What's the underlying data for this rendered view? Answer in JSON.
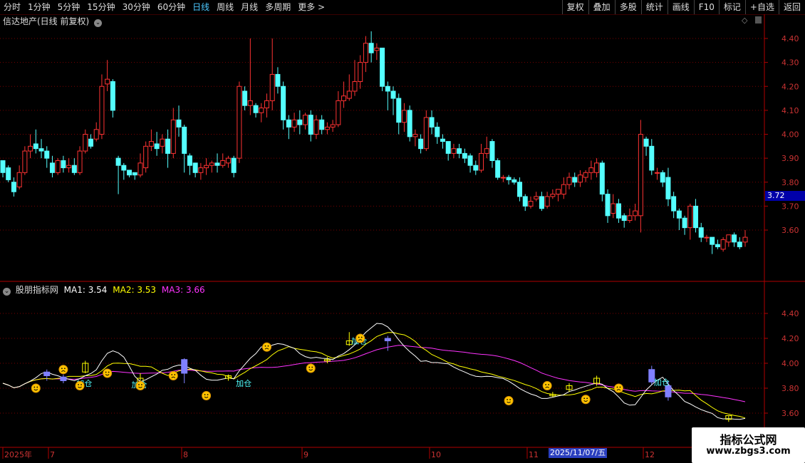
{
  "topbar": {
    "tabs": [
      "分时",
      "1分钟",
      "5分钟",
      "15分钟",
      "30分钟",
      "60分钟",
      "日线",
      "周线",
      "月线",
      "多周期",
      "更多 >"
    ],
    "active_tab": "日线",
    "tools": [
      "复权",
      "叠加",
      "多股",
      "统计",
      "画线",
      "F10",
      "标记",
      "+自选",
      "返回"
    ]
  },
  "main_pane": {
    "title": "信达地产(日线 前复权)",
    "price_labels": [
      "4.40",
      "4.30",
      "4.20",
      "4.10",
      "4.00",
      "3.90",
      "3.80",
      "3.70",
      "3.60"
    ],
    "current_price": "3.72"
  },
  "indicator_pane": {
    "name": "股朋指标网",
    "ma1_label": "MA1: 3.54",
    "ma2_label": "MA2: 3.53",
    "ma3_label": "MA3: 3.66",
    "ma1_color": "#ffffff",
    "ma2_color": "#ffff00",
    "ma3_color": "#ff33ff",
    "price_labels": [
      "4.40",
      "4.20",
      "4.00",
      "3.80",
      "3.60"
    ],
    "annotation_text": "加仓"
  },
  "time_axis": {
    "labels": [
      "2025年",
      "7",
      "8",
      "9",
      "10",
      "11",
      "12"
    ],
    "cursor_date": "2025/11/07/五"
  },
  "watermark": {
    "line1": "指标公式网",
    "line2": "www.zbgs3.com"
  },
  "colors": {
    "up": "#ff3333",
    "down": "#54ffff",
    "grid": "#7a0000",
    "axis_text": "#cc3333"
  },
  "chart_data": {
    "type": "candlestick",
    "y_range": [
      3.5,
      4.45
    ],
    "ohlc": [
      [
        3.89,
        3.84,
        3.82,
        3.89
      ],
      [
        3.86,
        3.81,
        3.8,
        3.87
      ],
      [
        3.8,
        3.76,
        3.74,
        3.82
      ],
      [
        3.78,
        3.84,
        3.77,
        3.87
      ],
      [
        3.84,
        3.93,
        3.83,
        3.95
      ],
      [
        3.93,
        3.95,
        3.9,
        4.0
      ],
      [
        3.96,
        3.94,
        3.92,
        4.02
      ],
      [
        3.94,
        3.93,
        3.9,
        3.98
      ],
      [
        3.93,
        3.9,
        3.86,
        3.95
      ],
      [
        3.88,
        3.84,
        3.82,
        3.91
      ],
      [
        3.84,
        3.89,
        3.83,
        3.9
      ],
      [
        3.89,
        3.86,
        3.84,
        3.91
      ],
      [
        3.86,
        3.87,
        3.84,
        3.9
      ],
      [
        3.87,
        3.84,
        3.83,
        3.9
      ],
      [
        3.84,
        3.93,
        3.83,
        3.95
      ],
      [
        3.93,
        4.0,
        3.92,
        4.02
      ],
      [
        3.98,
        3.95,
        3.94,
        4.0
      ],
      [
        3.98,
        4.02,
        3.97,
        4.05
      ],
      [
        4.0,
        4.2,
        3.98,
        4.25
      ],
      [
        4.21,
        4.23,
        4.18,
        4.31
      ],
      [
        4.22,
        4.1,
        4.07,
        4.23
      ],
      [
        3.9,
        3.87,
        3.75,
        3.91
      ],
      [
        3.87,
        3.85,
        3.81,
        3.88
      ],
      [
        3.85,
        3.83,
        3.82,
        3.85
      ],
      [
        3.84,
        3.83,
        3.81,
        3.84
      ],
      [
        3.83,
        3.88,
        3.82,
        3.92
      ],
      [
        3.86,
        3.95,
        3.84,
        3.97
      ],
      [
        3.95,
        3.97,
        3.93,
        4.02
      ],
      [
        3.96,
        3.94,
        3.91,
        4.01
      ],
      [
        3.95,
        3.98,
        3.92,
        4.0
      ],
      [
        3.98,
        3.92,
        3.86,
        4.02
      ],
      [
        3.92,
        4.06,
        3.9,
        4.11
      ],
      [
        4.06,
        4.03,
        3.99,
        4.12
      ],
      [
        4.03,
        3.92,
        3.84,
        4.04
      ],
      [
        3.91,
        3.87,
        3.83,
        3.92
      ],
      [
        3.88,
        3.84,
        3.82,
        3.86
      ],
      [
        3.84,
        3.86,
        3.81,
        3.88
      ],
      [
        3.86,
        3.87,
        3.83,
        3.9
      ],
      [
        3.87,
        3.88,
        3.84,
        3.89
      ],
      [
        3.88,
        3.87,
        3.84,
        3.92
      ],
      [
        3.87,
        3.89,
        3.86,
        3.92
      ],
      [
        3.88,
        3.9,
        3.86,
        3.91
      ],
      [
        3.9,
        3.84,
        3.82,
        3.91
      ],
      [
        3.9,
        4.2,
        3.88,
        4.22
      ],
      [
        4.18,
        4.12,
        4.1,
        4.2
      ],
      [
        4.12,
        4.14,
        4.08,
        4.4
      ],
      [
        4.12,
        4.09,
        4.07,
        4.13
      ],
      [
        4.09,
        4.11,
        4.05,
        4.13
      ],
      [
        4.11,
        4.14,
        4.07,
        4.17
      ],
      [
        4.14,
        4.25,
        4.1,
        4.4
      ],
      [
        4.25,
        4.2,
        4.17,
        4.28
      ],
      [
        4.2,
        4.06,
        4.02,
        4.22
      ],
      [
        4.06,
        4.03,
        3.98,
        4.08
      ],
      [
        4.03,
        4.06,
        4.01,
        4.09
      ],
      [
        4.06,
        4.04,
        4.0,
        4.1
      ],
      [
        4.04,
        4.08,
        4.02,
        4.09
      ],
      [
        4.08,
        4.0,
        3.97,
        4.1
      ],
      [
        4.0,
        4.06,
        3.98,
        4.08
      ],
      [
        4.06,
        4.02,
        4.0,
        4.08
      ],
      [
        4.02,
        4.03,
        4.0,
        4.05
      ],
      [
        4.03,
        4.04,
        4.01,
        4.06
      ],
      [
        4.04,
        4.14,
        4.03,
        4.18
      ],
      [
        4.14,
        4.16,
        4.11,
        4.22
      ],
      [
        4.15,
        4.18,
        4.14,
        4.25
      ],
      [
        4.18,
        4.22,
        4.16,
        4.31
      ],
      [
        4.22,
        4.3,
        4.19,
        4.33
      ],
      [
        4.3,
        4.38,
        4.26,
        4.41
      ],
      [
        4.38,
        4.34,
        4.3,
        4.43
      ],
      [
        4.35,
        4.36,
        4.31,
        4.38
      ],
      [
        4.36,
        4.2,
        4.18,
        4.36
      ],
      [
        4.2,
        4.18,
        4.1,
        4.22
      ],
      [
        4.18,
        4.15,
        4.08,
        4.2
      ],
      [
        4.15,
        4.05,
        4.0,
        4.17
      ],
      [
        4.05,
        4.1,
        4.01,
        4.13
      ],
      [
        4.1,
        3.99,
        3.97,
        4.12
      ],
      [
        3.99,
        4.0,
        3.95,
        4.02
      ],
      [
        3.98,
        3.94,
        3.92,
        4.0
      ],
      [
        3.94,
        4.07,
        3.93,
        4.1
      ],
      [
        4.07,
        4.03,
        4.0,
        4.1
      ],
      [
        4.03,
        3.99,
        3.96,
        4.05
      ],
      [
        3.98,
        3.97,
        3.94,
        4.0
      ],
      [
        3.97,
        3.92,
        3.89,
        3.97
      ],
      [
        3.92,
        3.94,
        3.9,
        3.96
      ],
      [
        3.94,
        3.92,
        3.9,
        3.96
      ],
      [
        3.92,
        3.9,
        3.88,
        3.94
      ],
      [
        3.91,
        3.87,
        3.84,
        3.92
      ],
      [
        3.87,
        3.85,
        3.83,
        3.89
      ],
      [
        3.85,
        3.92,
        3.84,
        3.96
      ],
      [
        3.92,
        3.94,
        3.9,
        3.99
      ],
      [
        3.97,
        3.89,
        3.86,
        3.98
      ],
      [
        3.89,
        3.82,
        3.81,
        3.9
      ],
      [
        3.82,
        3.82,
        3.8,
        3.83
      ],
      [
        3.82,
        3.81,
        3.79,
        3.83
      ],
      [
        3.81,
        3.8,
        3.79,
        3.82
      ],
      [
        3.8,
        3.74,
        3.72,
        3.82
      ],
      [
        3.74,
        3.7,
        3.68,
        3.75
      ],
      [
        3.7,
        3.72,
        3.69,
        3.74
      ],
      [
        3.73,
        3.74,
        3.72,
        3.76
      ],
      [
        3.74,
        3.69,
        3.68,
        3.76
      ],
      [
        3.7,
        3.74,
        3.69,
        3.76
      ],
      [
        3.74,
        3.75,
        3.73,
        3.77
      ],
      [
        3.75,
        3.77,
        3.72,
        3.77
      ],
      [
        3.75,
        3.79,
        3.73,
        3.82
      ],
      [
        3.79,
        3.82,
        3.77,
        3.84
      ],
      [
        3.82,
        3.8,
        3.78,
        3.84
      ],
      [
        3.8,
        3.83,
        3.78,
        3.85
      ],
      [
        3.82,
        3.84,
        3.8,
        3.85
      ],
      [
        3.84,
        3.86,
        3.81,
        3.89
      ],
      [
        3.84,
        3.88,
        3.82,
        3.9
      ],
      [
        3.88,
        3.75,
        3.72,
        3.89
      ],
      [
        3.75,
        3.66,
        3.63,
        3.77
      ],
      [
        3.67,
        3.71,
        3.65,
        3.75
      ],
      [
        3.71,
        3.65,
        3.63,
        3.73
      ],
      [
        3.66,
        3.64,
        3.61,
        3.67
      ],
      [
        3.64,
        3.66,
        3.63,
        3.69
      ],
      [
        3.66,
        3.68,
        3.64,
        3.71
      ],
      [
        3.66,
        4.0,
        3.59,
        4.06
      ],
      [
        3.98,
        3.95,
        3.91,
        3.99
      ],
      [
        3.95,
        3.85,
        3.83,
        3.98
      ],
      [
        3.84,
        3.84,
        3.81,
        3.86
      ],
      [
        3.84,
        3.8,
        3.78,
        3.85
      ],
      [
        3.82,
        3.73,
        3.7,
        3.86
      ],
      [
        3.74,
        3.68,
        3.65,
        3.76
      ],
      [
        3.68,
        3.65,
        3.6,
        3.69
      ],
      [
        3.65,
        3.61,
        3.58,
        3.66
      ],
      [
        3.61,
        3.7,
        3.56,
        3.71
      ],
      [
        3.7,
        3.61,
        3.59,
        3.73
      ],
      [
        3.61,
        3.57,
        3.55,
        3.63
      ],
      [
        3.57,
        3.57,
        3.55,
        3.58
      ],
      [
        3.57,
        3.54,
        3.5,
        3.57
      ],
      [
        3.54,
        3.53,
        3.52,
        3.56
      ],
      [
        3.52,
        3.56,
        3.51,
        3.57
      ],
      [
        3.55,
        3.58,
        3.53,
        3.58
      ],
      [
        3.58,
        3.55,
        3.53,
        3.59
      ],
      [
        3.55,
        3.53,
        3.52,
        3.57
      ],
      [
        3.55,
        3.57,
        3.53,
        3.6
      ]
    ]
  }
}
